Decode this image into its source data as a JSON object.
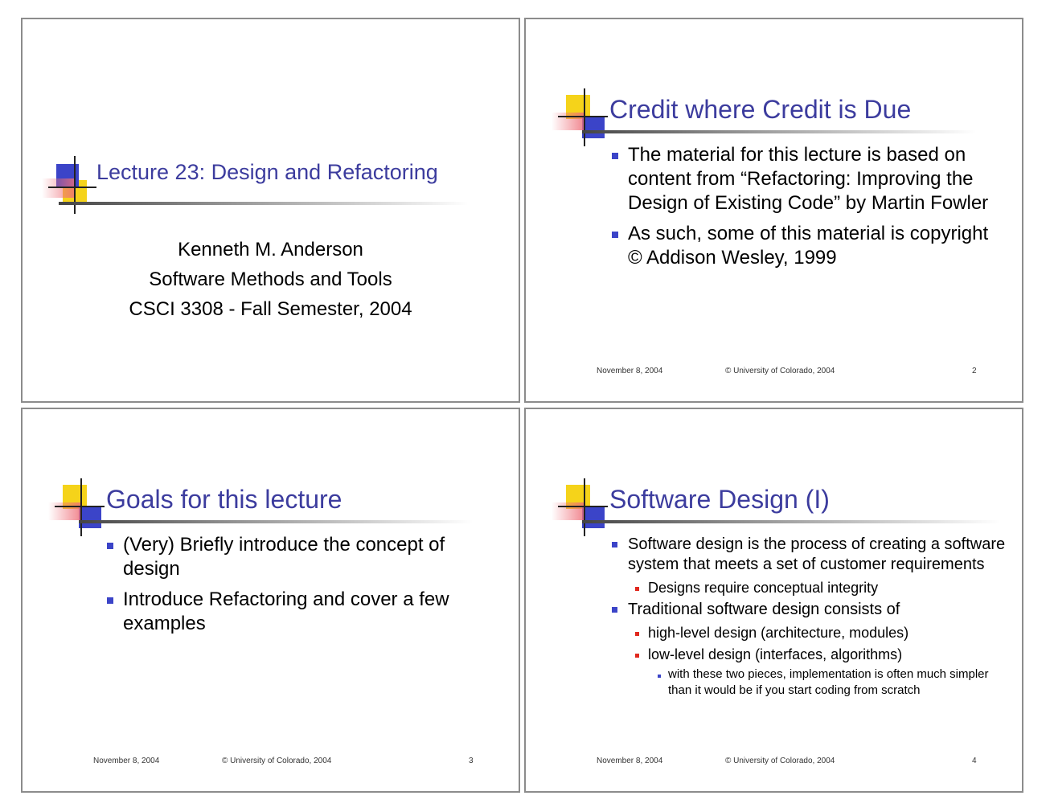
{
  "slides": [
    {
      "title": "Lecture 23: Design and Refactoring",
      "subtitle_lines": [
        "Kenneth M. Anderson",
        "Software Methods and Tools",
        "CSCI 3308 - Fall Semester, 2004"
      ]
    },
    {
      "title": "Credit where Credit is Due",
      "bullets": [
        "The material for this lecture is based on content from “Refactoring: Improving the Design of Existing Code” by Martin Fowler",
        "As such, some of this material is copyright © Addison Wesley, 1999"
      ],
      "footer": {
        "date": "November 8, 2004",
        "copyright": "© University of Colorado, 2004",
        "page": "2"
      }
    },
    {
      "title": "Goals for this lecture",
      "bullets": [
        "(Very) Briefly introduce the concept of design",
        "Introduce Refactoring and cover a few examples"
      ],
      "footer": {
        "date": "November 8, 2004",
        "copyright": "© University of Colorado, 2004",
        "page": "3"
      }
    },
    {
      "title": "Software Design (I)",
      "bullets": [
        "Software design is the process of creating a software system that meets a set of customer requirements",
        "Designs require conceptual integrity",
        "Traditional software design consists of",
        "high-level design (architecture, modules)",
        "low-level design (interfaces, algorithms)",
        "with these two pieces, implementation is often much simpler than it would be if you start coding from scratch"
      ],
      "footer": {
        "date": "November 8, 2004",
        "copyright": "© University of Colorado, 2004",
        "page": "4"
      }
    }
  ]
}
